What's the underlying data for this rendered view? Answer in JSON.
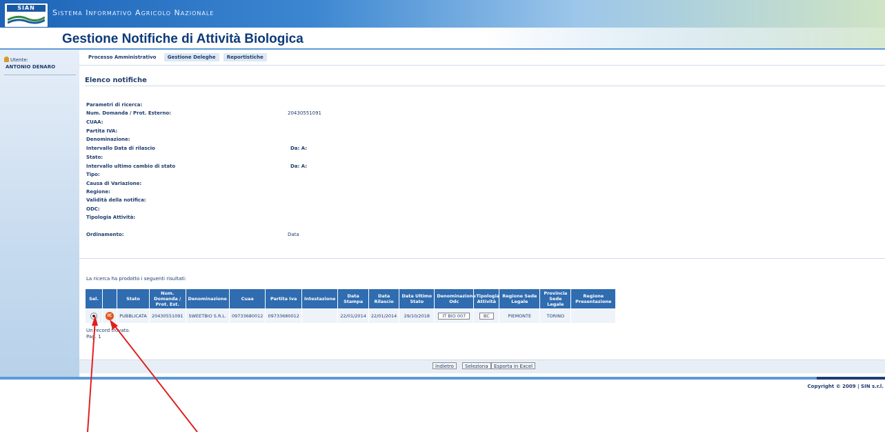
{
  "banner": {
    "logo_text": "SIAN",
    "system_name": "Sistema Informativo Agricolo Nazionale",
    "app_title": "Gestione Notifiche di Attività Biologica"
  },
  "sidebar": {
    "user_label": "Utente:",
    "user_name": "ANTONIO DENARO"
  },
  "tabs": [
    {
      "label": "Processo Amministrativo"
    },
    {
      "label": "Gestione Deleghe"
    },
    {
      "label": "Reportistiche"
    }
  ],
  "section_title": "Elenco notifiche",
  "params": {
    "header": "Parametri di ricerca:",
    "rows": [
      {
        "label": "Num. Domanda / Prot. Esterno:",
        "value": "20430551091"
      },
      {
        "label": "CUAA:",
        "value": ""
      },
      {
        "label": "Partita IVA:",
        "value": ""
      },
      {
        "label": "Denominazione:",
        "value": ""
      },
      {
        "label": "Intervallo Data di rilascio",
        "value": "Da: A:"
      },
      {
        "label": "Stato:",
        "value": ""
      },
      {
        "label": "Intervallo ultimo cambio di stato",
        "value": "Da: A:"
      },
      {
        "label": "Tipo:",
        "value": ""
      },
      {
        "label": "Causa di Variazione:",
        "value": ""
      },
      {
        "label": "Regione:",
        "value": ""
      },
      {
        "label": "Validità della notifica:",
        "value": ""
      },
      {
        "label": "ODC:",
        "value": ""
      },
      {
        "label": "Tipologia Attività:",
        "value": ""
      }
    ],
    "ordering_label": "Ordinamento:",
    "ordering_value": "Data"
  },
  "results": {
    "message": "La ricerca ha prodotto i seguenti risultati:",
    "columns": [
      "Sel.",
      "",
      "Stato",
      "Num. Domanda / Prot. Est.",
      "Denominazione",
      "Cuaa",
      "Partita Iva",
      "Intestazione",
      "Data Stampa",
      "Data Rilascio",
      "Data Ultimo Stato",
      "Denominazione Odc",
      "Tipologia Attività",
      "Regione Sede Legale",
      "Provincia Sede Legale",
      "Regione Presentazione"
    ],
    "row": {
      "status_icon": "IC",
      "stato": "PUBBLICATA",
      "num_domanda": "20430551091",
      "denominazione": "SWEETBIO S.R.L.",
      "cuaa": "09733680012",
      "partita_iva": "09733680012",
      "intestazione": "",
      "data_stampa": "22/01/2014",
      "data_rilascio": "22/01/2014",
      "data_ultimo_stato": "29/10/2018",
      "odc": "IT BIO 007",
      "tipologia": "BC",
      "regione_sede": "PIEMONTE",
      "provincia_sede": "TORINO",
      "regione_presentazione": ""
    },
    "records_found": "Un record trovato.",
    "page": "Pag. 1"
  },
  "buttons": {
    "back": "Indietro",
    "select": "Seleziona",
    "export": "Esporta in Excel"
  },
  "copyright": "Copyright © 2009 | SIN s.r.l.",
  "colors": {
    "header_blue": "#2f6cb0",
    "status_orange": "#e0541d",
    "annotation_red": "#e02020"
  }
}
